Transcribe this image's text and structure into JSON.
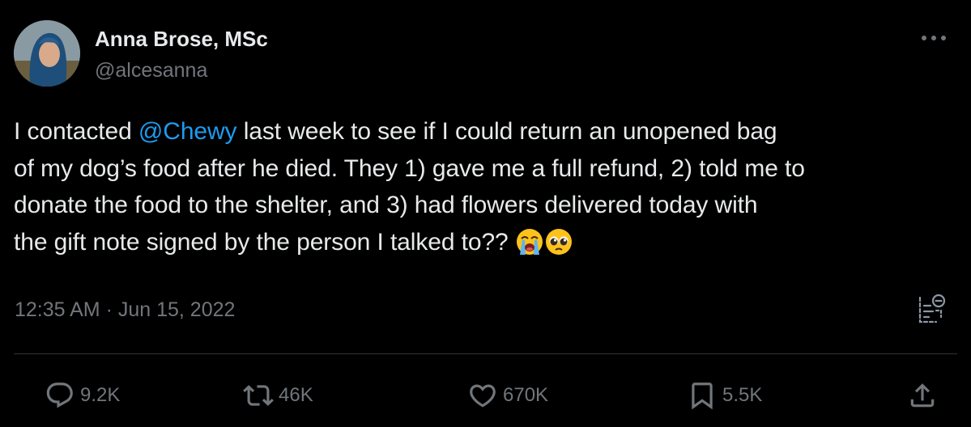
{
  "author": {
    "display_name": "Anna Brose, MSc",
    "handle": "@alcesanna"
  },
  "tweet": {
    "lines": [
      {
        "before": "I contacted ",
        "mention": "@Chewy",
        "after": " last week to see if I could return an unopened bag"
      },
      {
        "text": "of my dog’s food after he died. They 1) gave me a full refund, 2) told me to"
      },
      {
        "text": "donate the food to the shelter, and 3) had flowers delivered today with"
      },
      {
        "text": "the gift note signed by the person I talked to??"
      }
    ],
    "emojis": [
      "loudly-crying-face-emoji",
      "pleading-face-emoji"
    ],
    "timestamp": "12:35 AM · Jun 15, 2022"
  },
  "actions": {
    "reply": {
      "icon": "reply-icon",
      "count": "9.2K"
    },
    "retweet": {
      "icon": "retweet-icon",
      "count": "46K"
    },
    "like": {
      "icon": "heart-icon",
      "count": "670K"
    },
    "bookmark": {
      "icon": "bookmark-icon",
      "count": "5.5K"
    },
    "share": {
      "icon": "share-icon"
    }
  },
  "colors": {
    "background": "#000000",
    "primary_text": "#e7e9ea",
    "secondary_text": "#71767b",
    "link": "#1d9bf0",
    "divider": "#2f3336"
  }
}
